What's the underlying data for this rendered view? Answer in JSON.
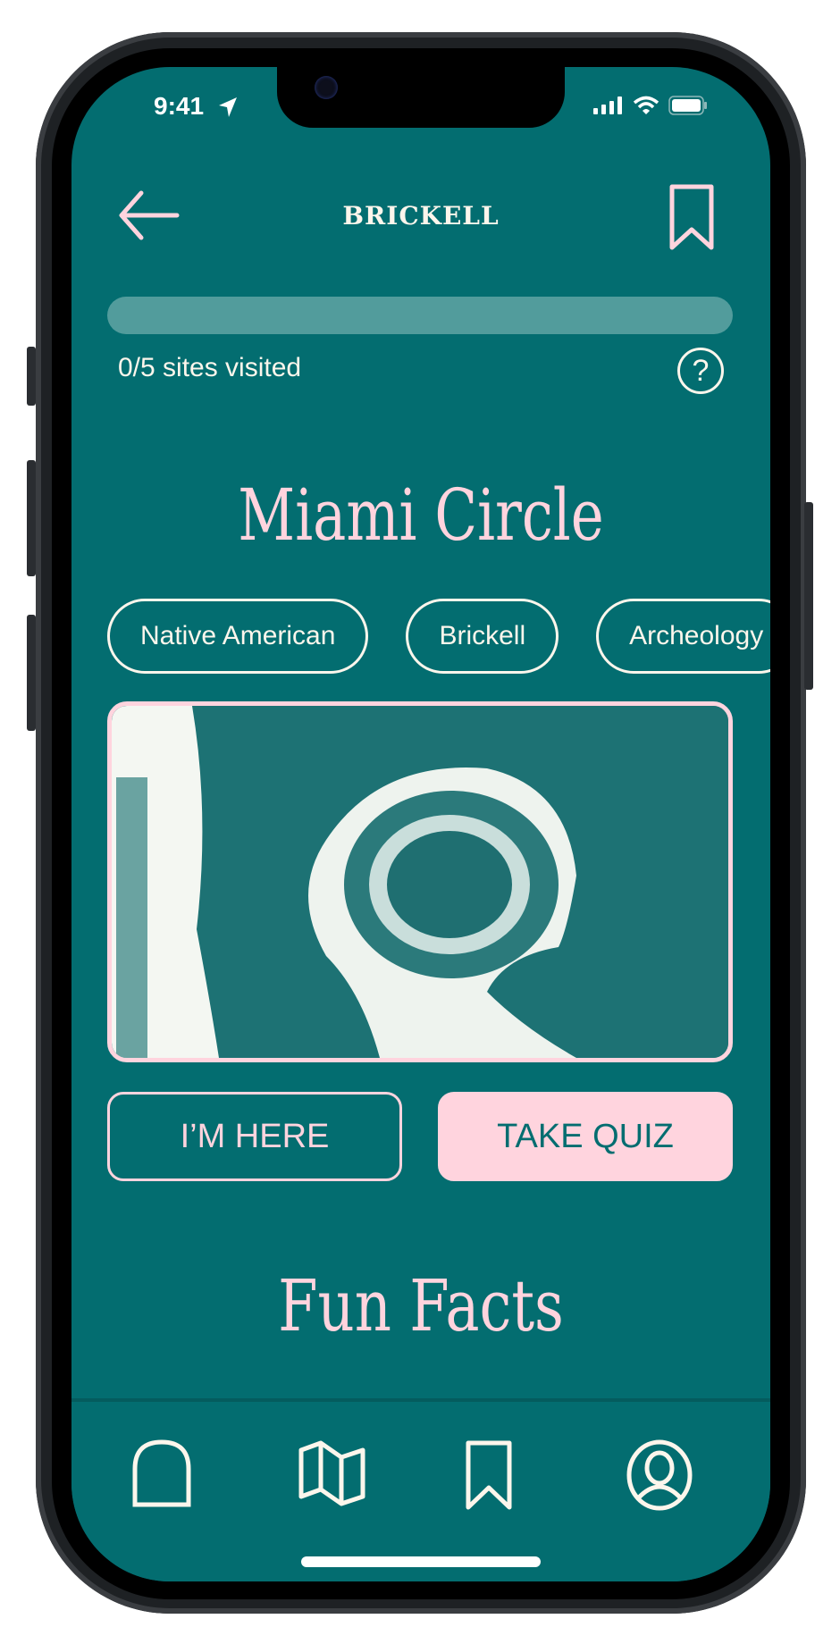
{
  "status_bar": {
    "time": "9:41"
  },
  "header": {
    "title": "BRICKELL",
    "back_icon": "arrow-left-icon",
    "bookmark_icon": "bookmark-icon"
  },
  "progress": {
    "visited": 0,
    "total": 5,
    "fraction": 0,
    "label": "0/5 sites visited",
    "help_icon": "question-circle-icon"
  },
  "site": {
    "name": "Miami Circle",
    "tags": [
      "Native American",
      "Brickell",
      "Archeology"
    ],
    "image_alt": "Aerial view of Miami Circle"
  },
  "actions": {
    "here_label": "I’M HERE",
    "quiz_label": "TAKE QUIZ"
  },
  "section": {
    "title": "Fun Facts"
  },
  "nav": {
    "items": [
      {
        "name": "home",
        "icon": "arch-icon"
      },
      {
        "name": "map",
        "icon": "map-icon"
      },
      {
        "name": "saved",
        "icon": "bookmark-icon"
      },
      {
        "name": "profile",
        "icon": "user-circle-icon"
      }
    ]
  },
  "colors": {
    "background": "#036d70",
    "accent": "#ffd4de",
    "text": "#fdf6ec",
    "track": "#529c9c"
  }
}
